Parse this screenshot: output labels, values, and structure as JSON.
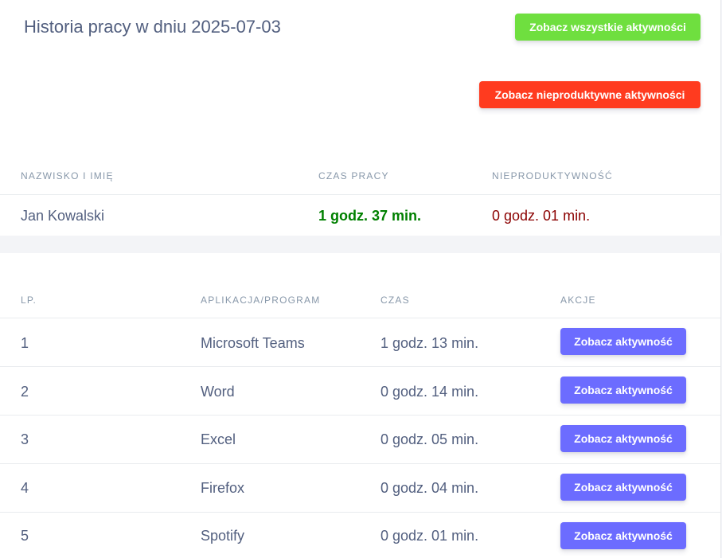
{
  "header": {
    "title": "Historia pracy w dniu 2025-07-03",
    "btn_all_label": "Zobacz wszystkie aktywności",
    "btn_unproductive_label": "Zobacz nieproduktywne aktywności",
    "btn_all_color": "#6fdf3f",
    "btn_unproductive_color": "#ff3b1f"
  },
  "summary": {
    "columns": [
      "NAZWISKO I IMIĘ",
      "CZAS PRACY",
      "NIEPRODUKTYWNOŚĆ"
    ],
    "name": "Jan Kowalski",
    "work_time": "1 godz. 37 min.",
    "unproductive_time": "0 godz. 01 min.",
    "work_time_color": "#008000",
    "unproductive_time_color": "#8b0000"
  },
  "activities": {
    "columns": [
      "LP.",
      "APLIKACJA/PROGRAM",
      "CZAS",
      "AKCJE"
    ],
    "action_label": "Zobacz aktywność",
    "action_color": "#6c6cff",
    "rows": [
      {
        "lp": "1",
        "app": "Microsoft Teams",
        "time": "1 godz. 13 min."
      },
      {
        "lp": "2",
        "app": "Word",
        "time": "0 godz. 14 min."
      },
      {
        "lp": "3",
        "app": "Excel",
        "time": "0 godz. 05 min."
      },
      {
        "lp": "4",
        "app": "Firefox",
        "time": "0 godz. 04 min."
      },
      {
        "lp": "5",
        "app": "Spotify",
        "time": "0 godz. 01 min."
      }
    ]
  }
}
